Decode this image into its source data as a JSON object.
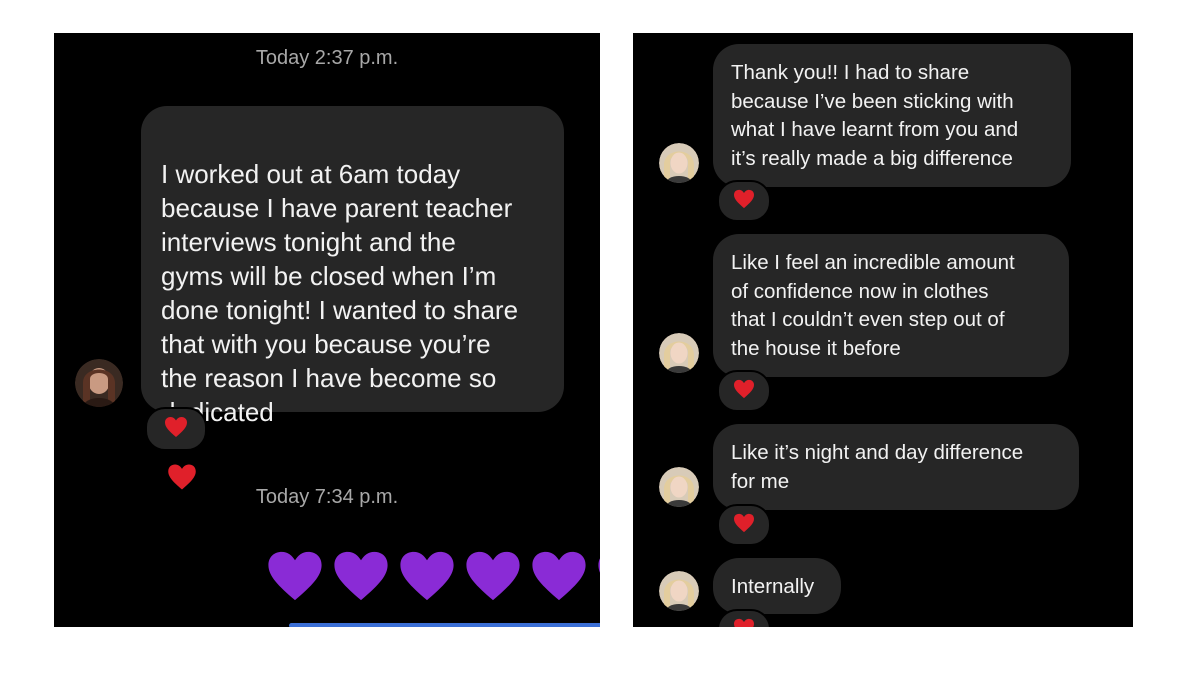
{
  "left_panel": {
    "timestamp_1": "Today 2:37 p.m.",
    "message_1": "I worked out at 6am today\nbecause I have parent teacher\ninterviews tonight and the\ngyms will be closed when I’m\ndone tonight! I wanted to share\nthat with you because you’re\nthe reason I have become so\ndedicated",
    "message_1_emoji": "red-heart-icon",
    "reaction_1": "red-heart-icon",
    "timestamp_2": "Today 7:34 p.m.",
    "emoji_row": [
      "purple-heart-icon",
      "purple-heart-icon",
      "purple-heart-icon",
      "purple-heart-icon",
      "purple-heart-icon",
      "purple-heart-icon"
    ]
  },
  "right_panel": {
    "messages": [
      {
        "text": "Thank you!! I had to share\nbecause I’ve been sticking with\nwhat I have learnt from you and\nit’s really made a big difference",
        "reaction": "red-heart-icon"
      },
      {
        "text": "Like I feel an incredible amount\nof confidence now in clothes\nthat I couldn’t even step out of\nthe house it before",
        "reaction": "red-heart-icon"
      },
      {
        "text": "Like it’s night and day difference\nfor me",
        "reaction": "red-heart-icon"
      },
      {
        "text": "Internally",
        "reaction": "red-heart-icon"
      }
    ]
  },
  "colors": {
    "background": "#000000",
    "bubble": "#262626",
    "text": "#f2f2f2",
    "timestamp": "#a8a8a8",
    "heart_red": "#e0202a",
    "heart_purple": "#8a2bd6"
  }
}
